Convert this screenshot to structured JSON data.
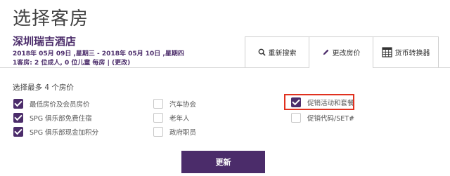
{
  "page": {
    "title": "选择客房"
  },
  "hotel": {
    "name": "深圳瑞吉酒店",
    "dates": "2018年 05月 09日 ,星期三 - 2018年 05月 10日 ,星期四",
    "occupancy": "1客房: 2 位成人, 0 位儿童 每房",
    "change_label": "(更改)"
  },
  "tabs": [
    {
      "label": "重新搜索",
      "icon": "search-icon"
    },
    {
      "label": "更改房价",
      "icon": "pencil-icon"
    },
    {
      "label": "货币转换器",
      "icon": "calculator-icon"
    }
  ],
  "rates": {
    "section_label": "选择最多 4 个房价",
    "options": [
      {
        "label": "最低房价及会员房价",
        "checked": true
      },
      {
        "label": "SPG 俱乐部免费住宿",
        "checked": true
      },
      {
        "label": "SPG 俱乐部现金加积分",
        "checked": true
      },
      {
        "label": "汽车协会",
        "checked": false
      },
      {
        "label": "老年人",
        "checked": false
      },
      {
        "label": "政府职员",
        "checked": false
      },
      {
        "label": "促销活动和套餐",
        "checked": true
      },
      {
        "label": "促销代码/SET#",
        "checked": false
      }
    ]
  },
  "actions": {
    "update_label": "更新"
  },
  "colors": {
    "brand": "#4b2c6a",
    "highlight": "#e0311f"
  }
}
